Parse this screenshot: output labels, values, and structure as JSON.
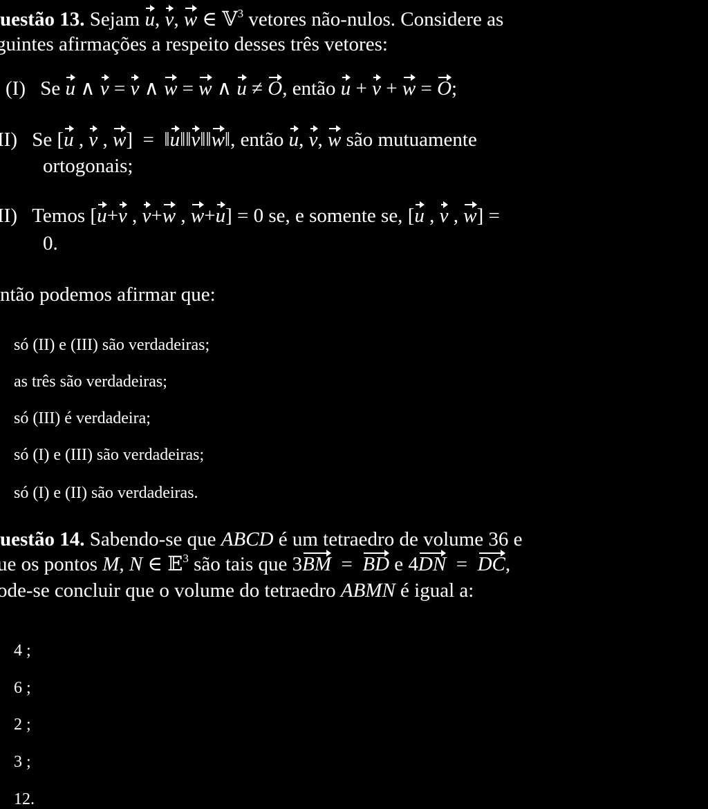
{
  "q13": {
    "title": "uestão 13.",
    "intro_1": "Sejam u, v, w ∈ 𝕍³ vetores não-nulos. Considere as",
    "intro_1_pre": "Sejam",
    "intro_1_set": "∈ 𝕍",
    "intro_1_sup": "3",
    "intro_1_post": "vetores não-nulos. Considere as",
    "intro_2": "guintes afirmações a respeito desses três vetores:",
    "statements": [
      {
        "label": "(I)",
        "text": "Se u ∧ v = v ∧ w = w ∧ u ≠ O, então u + v + w = O;"
      },
      {
        "label": "II)",
        "text_line_1": "Se [u, v, w] = ||u|| ||v|| ||w||, então u, v, w são mutuamente",
        "text_line_2": "ortogonais;"
      },
      {
        "label": "II)",
        "text_line_1": "Temos [u + v, v + w, w + u] = 0 se, e somente se, [u, v, w] =",
        "text_line_2": "0."
      }
    ],
    "conclusion": "ntão podemos afirmar que:",
    "options": [
      "só (II) e (III) são verdadeiras;",
      "as três são verdadeiras;",
      "só (III) é verdadeira;",
      "só (I) e (III) são verdadeiras;",
      "só (I) e (II) são verdadeiras."
    ]
  },
  "q14": {
    "title": "uestão 14.",
    "line_1": "Sabendo-se que ABCD é um tetraedro de volume 36 e",
    "line_1_pre": "Sabendo-se que",
    "line_1_abcd": "ABCD",
    "line_1_post": "é um tetraedro de volume 36 e",
    "line_2": "ue os pontos M, N ∈ 𝔼³ são tais que 3BM = BD e 4DN = DC,",
    "line_2_pre": "ue os pontos",
    "line_2_mn": "M, N",
    "line_2_set": "∈ 𝔼",
    "line_2_sup": "3",
    "line_2_mid": "são tais que 3",
    "line_2_eq": "=",
    "line_2_and": "e 4",
    "line_3": "ode-se concluir que o volume do tetraedro ABMN é igual a:",
    "line_3_pre": "ode-se concluir que o volume do tetraedro",
    "line_3_abmn": "ABMN",
    "line_3_post": "é igual a:",
    "options": [
      "4 ;",
      "6 ;",
      "2 ;",
      "3 ;",
      "12."
    ]
  },
  "symbols": {
    "u": "u",
    "v": "v",
    "w": "w",
    "O": "O",
    "BM": "BM",
    "BD": "BD",
    "DN": "DN",
    "DC": "DC",
    "wedge": "∧",
    "eq": "=",
    "neq": "≠",
    "plus": "+",
    "comma": ",",
    "semicolon": ";",
    "then": "então",
    "se": "Se",
    "temos": "Temos",
    "norm": "‖",
    "iff": "= 0 se, e somente se,",
    "mutual": "são mutuamente",
    "eq0": "="
  }
}
